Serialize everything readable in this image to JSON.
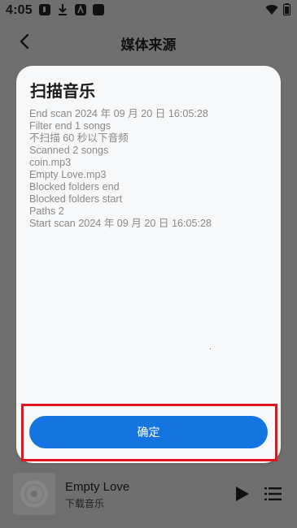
{
  "status_bar": {
    "time": "4:05",
    "icons_left": [
      "app-j-icon",
      "download-icon",
      "app-a-icon",
      "blank-app-icon"
    ],
    "icons_right": [
      "wifi-icon",
      "battery-icon"
    ]
  },
  "header": {
    "title": "媒体来源",
    "back_icon": "back-arrow-icon"
  },
  "dialog": {
    "title": "扫描音乐",
    "log_lines": [
      "End scan 2024 年 09 月 20 日 16:05:28",
      "Filter end 1 songs",
      "不扫描 60 秒以下音频",
      "Scanned 2 songs",
      "coin.mp3",
      "Empty Love.mp3",
      "Blocked folders end",
      "Blocked folders start",
      "Paths 2",
      "Start scan 2024 年 09 月 20 日 16:05:28"
    ],
    "confirm_label": "确定"
  },
  "player": {
    "track_title": "Empty Love",
    "track_subtitle": "下载音乐",
    "play_icon": "play-icon",
    "queue_icon": "playlist-icon"
  },
  "colors": {
    "overlay": "#6f6f6f",
    "dialog_bg": "#f7f8fa",
    "accent": "#1475e0",
    "highlight": "#e0151d",
    "log_text": "#8a8a8a"
  }
}
